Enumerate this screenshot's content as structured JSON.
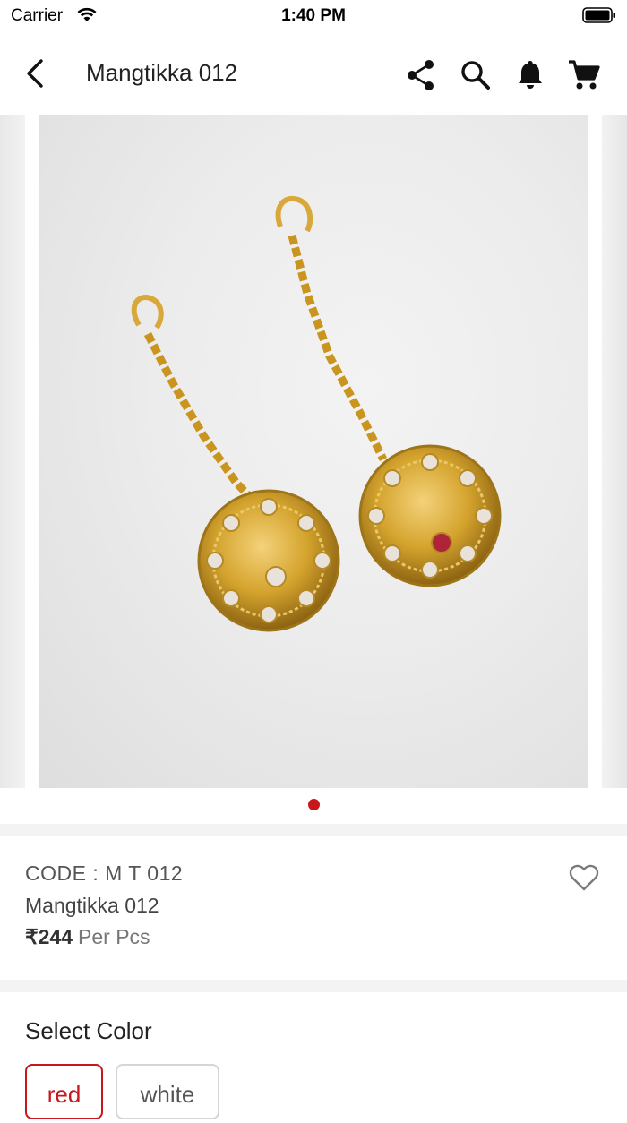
{
  "status_bar": {
    "carrier": "Carrier",
    "time": "1:40 PM"
  },
  "nav": {
    "title": "Mangtikka 012",
    "icons": [
      "back-arrow-icon",
      "share-icon",
      "search-icon",
      "bell-icon",
      "cart-icon"
    ]
  },
  "gallery": {
    "page_count": 1,
    "active_index": 0,
    "active_dot_color": "#c8161d"
  },
  "product": {
    "code": "CODE : M T 012",
    "name": "Mangtikka 012",
    "price": "₹244",
    "unit": "Per Pcs"
  },
  "colors": {
    "heading": "Select Color",
    "options": [
      "red",
      "white"
    ],
    "selected": "red",
    "accent": "#c8161d"
  }
}
